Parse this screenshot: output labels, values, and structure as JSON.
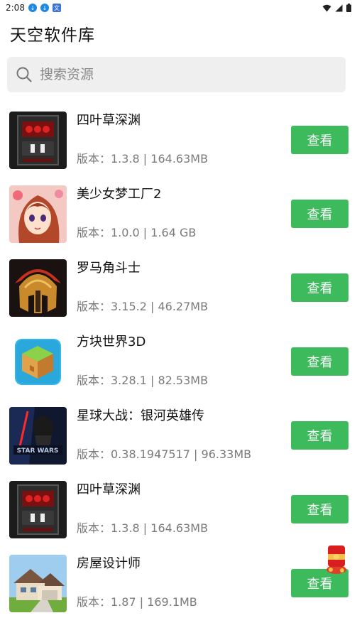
{
  "status_bar": {
    "time": "2:08",
    "notification_icons": [
      "download-icon",
      "download-icon",
      "translate-icon"
    ],
    "system_icons": [
      "wifi-icon",
      "signal-icon",
      "battery-icon"
    ]
  },
  "app": {
    "title": "天空软件库"
  },
  "search": {
    "placeholder": "搜索资源",
    "value": ""
  },
  "apps": [
    {
      "name": "四叶草深渊",
      "meta": "版本：1.3.8 | 164.63MB",
      "button": "查看",
      "icon": "arcade-machine-icon"
    },
    {
      "name": "美少女梦工厂2",
      "meta": "版本：1.0.0 | 1.64 GB",
      "button": "查看",
      "icon": "anime-girl-icon"
    },
    {
      "name": "罗马角斗士",
      "meta": "版本：3.15.2 | 46.27MB",
      "button": "查看",
      "icon": "gladiator-helmet-icon"
    },
    {
      "name": "方块世界3D",
      "meta": "版本：3.28.1 | 82.53MB",
      "button": "查看",
      "icon": "block-cube-icon"
    },
    {
      "name": "星球大战：银河英雄传",
      "meta": "版本：0.38.1947517 | 96.33MB",
      "button": "查看",
      "icon": "star-wars-icon"
    },
    {
      "name": "四叶草深渊",
      "meta": "版本：1.3.8 | 164.63MB",
      "button": "查看",
      "icon": "arcade-machine-icon"
    },
    {
      "name": "房屋设计师",
      "meta": "版本：1.87 | 169.1MB",
      "button": "查看",
      "icon": "house-icon"
    }
  ],
  "floating": {
    "red_packet_icon": "red-packet-icon"
  },
  "colors": {
    "button_green": "#3dbb5c",
    "search_bg": "#efefef",
    "meta_gray": "#7a7a7a"
  }
}
